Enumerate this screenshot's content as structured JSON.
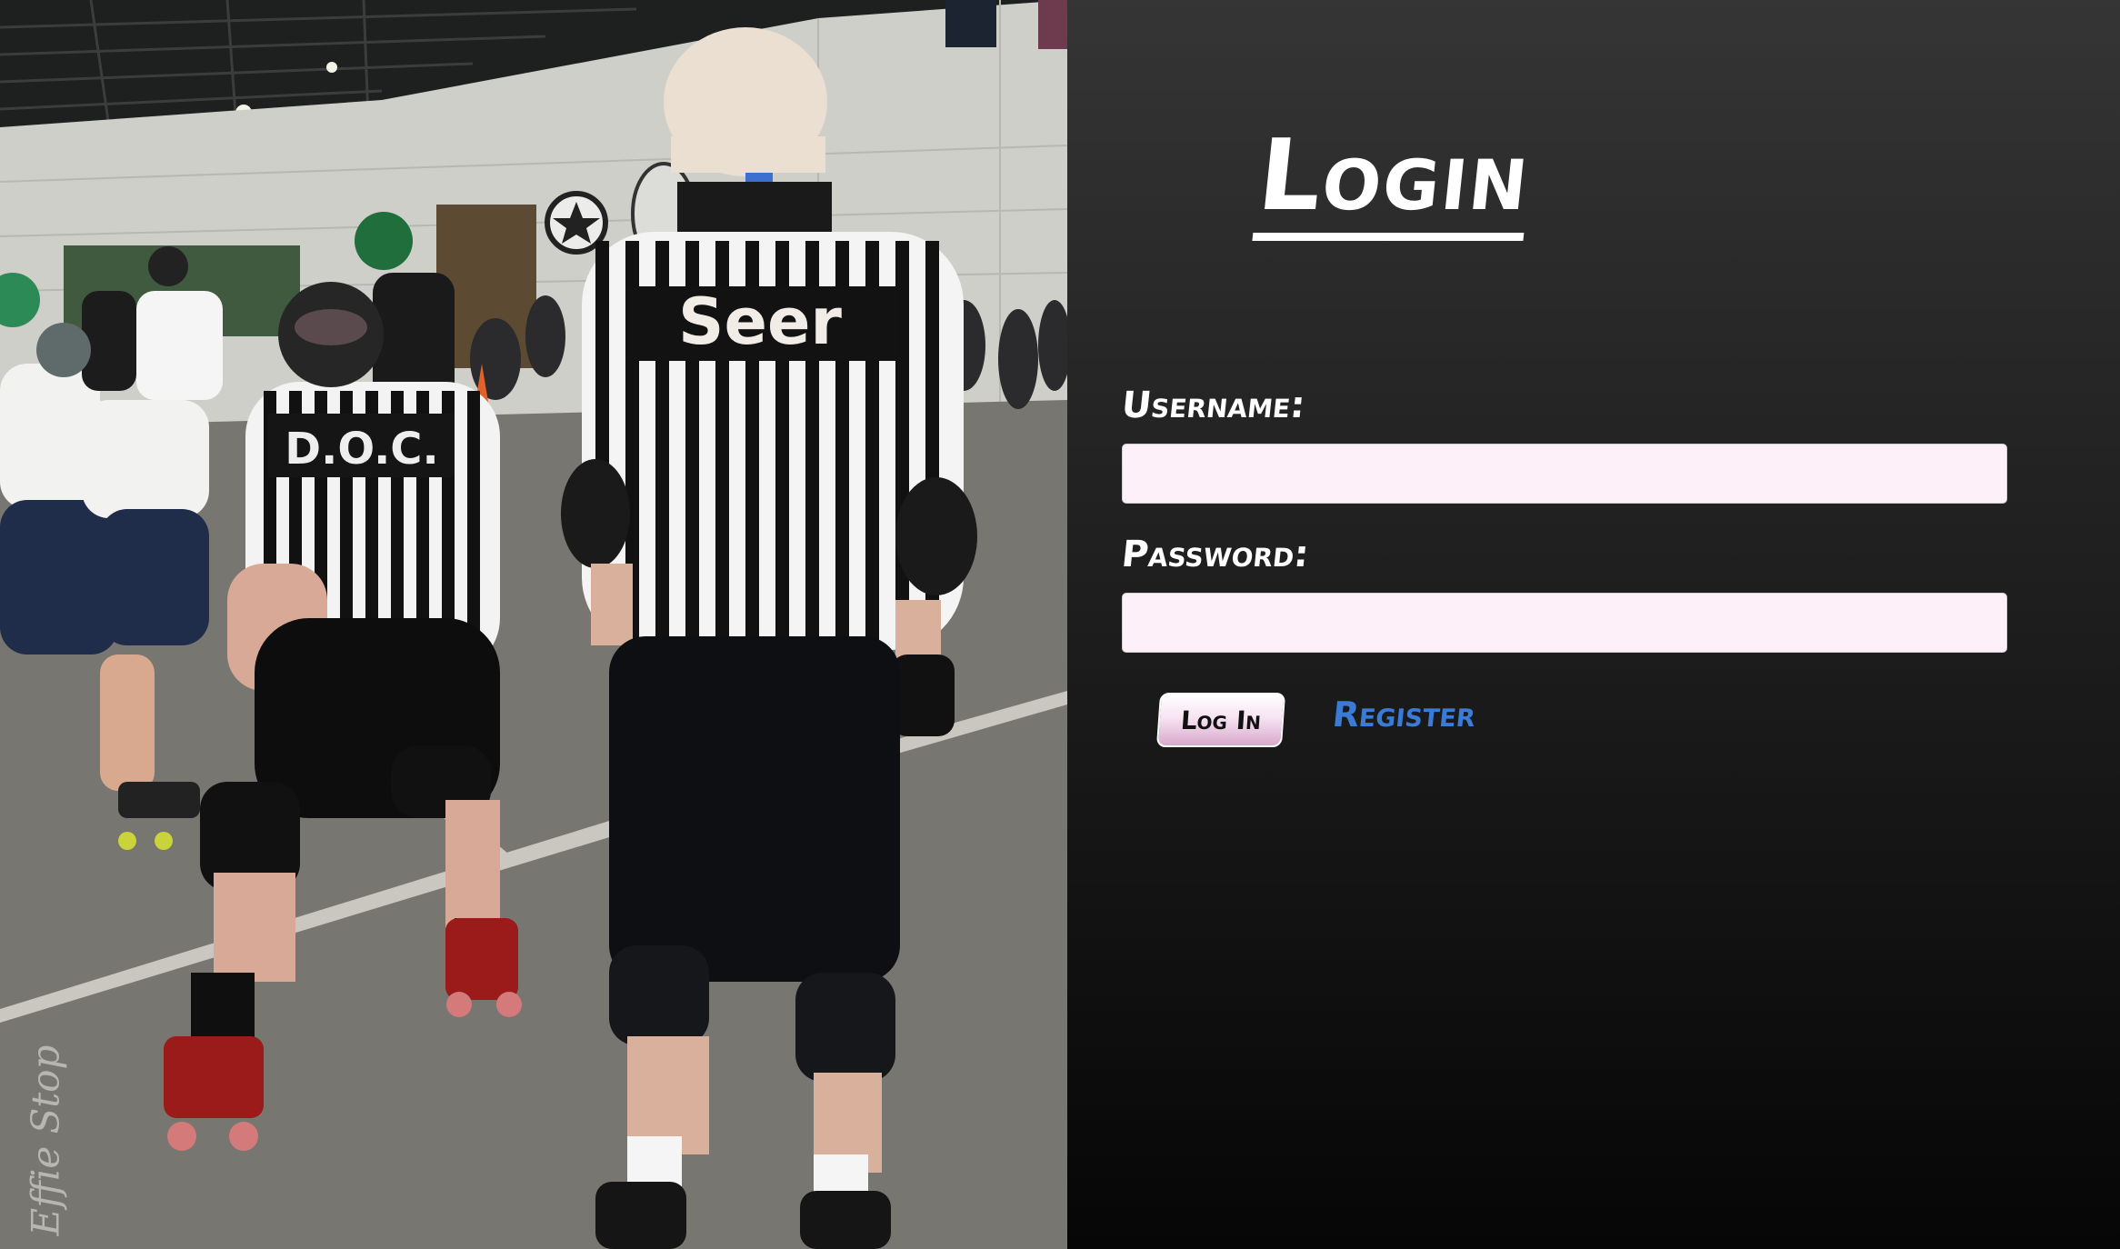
{
  "photo": {
    "description_icon": "photo-icon",
    "shirt_back_text": "Seer",
    "shirt_back_text_2": "D.O.C.",
    "watermark": "Effie Stop"
  },
  "login": {
    "title": "Login",
    "username_label": "Username:",
    "username_value": "",
    "password_label": "Password:",
    "password_value": "",
    "login_button_label": "Log In",
    "register_link_label": "Register"
  },
  "colors": {
    "panel_bg_top": "#353535",
    "panel_bg_bottom": "#060606",
    "input_bg": "#fdf0f8",
    "register_link": "#3a7bd5",
    "button_gradient_bottom": "#d8a9cc"
  }
}
